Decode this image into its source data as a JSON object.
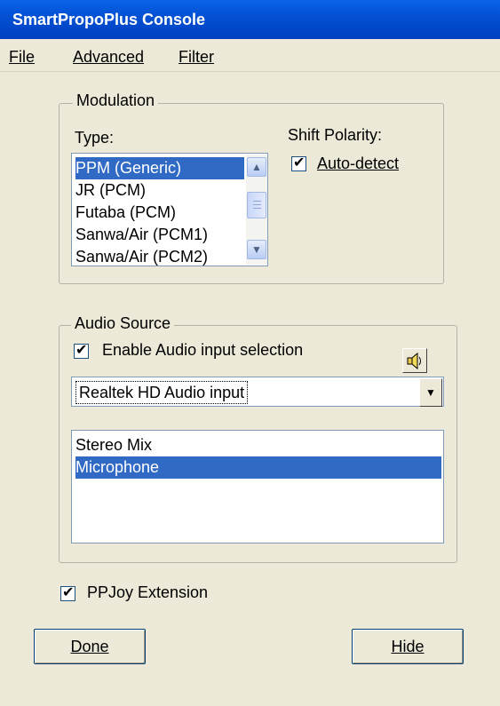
{
  "window": {
    "title": "SmartPropoPlus Console"
  },
  "menu": {
    "file": "File",
    "advanced": "Advanced",
    "filter": "Filter"
  },
  "modulation": {
    "group_label": "Modulation",
    "type_label": "Type:",
    "types": [
      "PPM (Generic)",
      "JR (PCM)",
      "Futaba (PCM)",
      "Sanwa/Air (PCM1)",
      "Sanwa/Air (PCM2)"
    ],
    "selected_type": "PPM (Generic)",
    "shift_polarity_label": "Shift Polarity:",
    "auto_detect_label": "Auto-detect",
    "auto_detect_checked": true
  },
  "audio_source": {
    "group_label": "Audio Source",
    "enable_label": "Enable Audio input selection",
    "enable_checked": true,
    "device": "Realtek HD Audio input",
    "inputs": [
      "Stereo Mix",
      "Microphone"
    ],
    "selected_input": "Microphone"
  },
  "ppjoy": {
    "label": "PPJoy Extension",
    "checked": true
  },
  "buttons": {
    "done": "Done",
    "hide": "Hide"
  },
  "icons": {
    "scroll_up": "scroll-up-icon",
    "scroll_down": "scroll-down-icon",
    "combo_dropdown": "chevron-down-icon",
    "speaker": "speaker-icon",
    "checkmark": "checkmark-icon"
  }
}
